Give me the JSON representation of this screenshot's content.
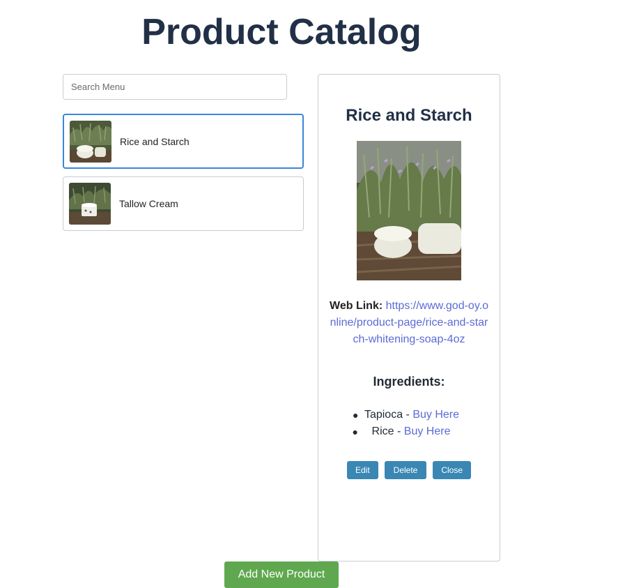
{
  "page": {
    "title": "Product Catalog"
  },
  "search": {
    "placeholder": "Search Menu",
    "value": ""
  },
  "products": [
    {
      "label": "Rice and Starch",
      "selected": true,
      "thumb_icon": "soap-bars-photo"
    },
    {
      "label": "Tallow Cream",
      "selected": false,
      "thumb_icon": "cream-jar-photo"
    }
  ],
  "detail": {
    "title": "Rice and Starch",
    "image_icon": "soap-bars-photo",
    "weblink_label": "Web Link:",
    "weblink_url": "https://www.god-oy.online/product-page/rice-and-starch-whitening-soap-4oz",
    "ingredients_title": "Ingredients:",
    "ingredients": [
      {
        "name": "Tapioca",
        "separator": " - ",
        "link_label": "Buy Here"
      },
      {
        "name": "Rice",
        "separator": " - ",
        "link_label": "Buy Here"
      }
    ],
    "buttons": {
      "edit": "Edit",
      "delete": "Delete",
      "close": "Close"
    }
  },
  "add_button": {
    "label": "Add New Product"
  },
  "colors": {
    "title": "#223047",
    "link": "#5a6bd6",
    "action_button": "#3a87b4",
    "add_button": "#5fa84f",
    "selected_border": "#3b86d9"
  }
}
